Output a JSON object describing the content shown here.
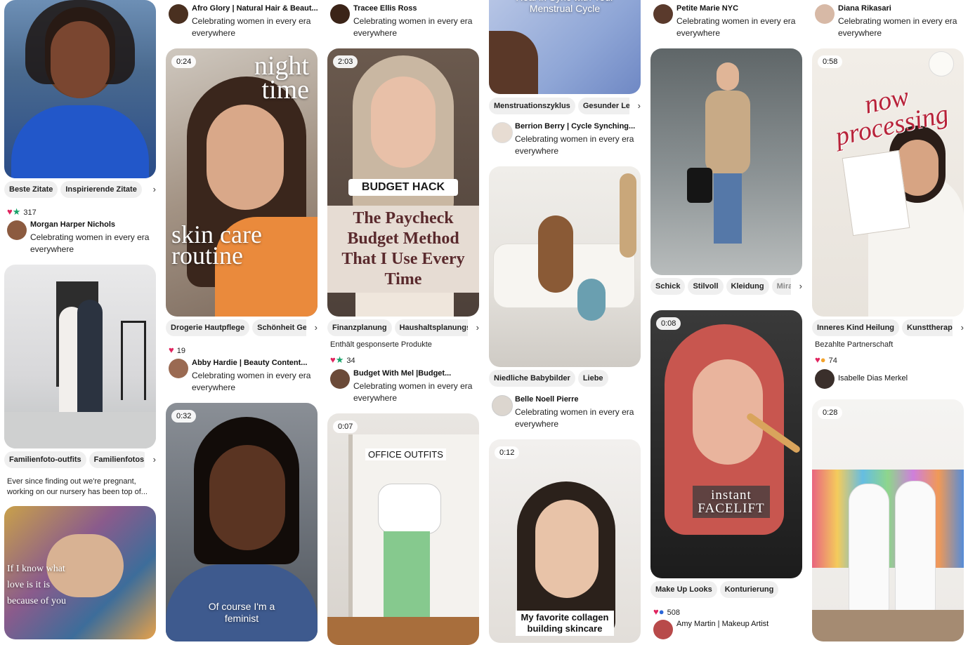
{
  "columns": [
    {
      "pins": [
        {
          "image": "woman in blue top smiling, curly hair",
          "tags": [
            "Beste Zitate",
            "Inspirierende Zitate"
          ],
          "reactions": {
            "count": "317"
          },
          "author": "Morgan Harper Nichols",
          "bio": "Celebrating women in every era everywhere"
        },
        {
          "image": "couple kissing in front of house",
          "tags": [
            "Familienfoto-outfits",
            "Familienfotos"
          ],
          "caption": "Ever since finding out we're pregnant, working on our nursery has been top of..."
        },
        {
          "image": "illustration hands with text",
          "overlay": "If I know what love is it is because of you"
        }
      ]
    },
    {
      "pins": [
        {
          "author": "Afro Glory | Natural Hair & Beaut...",
          "bio": "Celebrating women in every era everywhere"
        },
        {
          "duration": "0:24",
          "overlay_top": "night time",
          "overlay_bottom": "skin care routine",
          "tags": [
            "Drogerie Hautpflege",
            "Schönheit Geh"
          ],
          "reactions": {
            "count": "19"
          },
          "author": "Abby Hardie | Beauty Content...",
          "bio": "Celebrating women in every era everywhere"
        },
        {
          "duration": "0:32",
          "overlay": "Of course I'm a feminist"
        }
      ]
    },
    {
      "pins": [
        {
          "author": "Tracee Ellis Ross",
          "bio": "Celebrating women in every era everywhere"
        },
        {
          "duration": "2:03",
          "badge": "BUDGET HACK",
          "overlay": "The Paycheck Budget Method That I Use Every Time",
          "tags": [
            "Finanzplanung",
            "Haushaltsplanungsti"
          ],
          "sponsored": "Enthält gesponserte Produkte",
          "reactions": {
            "count": "34"
          },
          "author": "Budget With Mel |Budget...",
          "bio": "Celebrating women in every era everywhere"
        },
        {
          "duration": "0:07",
          "overlay": "OFFICE OUTFITS"
        }
      ]
    },
    {
      "pins": [
        {
          "overlay": "Heal in Sync with Your Menstrual Cycle",
          "tags": [
            "Menstruationszyklus",
            "Gesunder Lebe"
          ],
          "author": "Berrion Berry | Cycle Synching...",
          "bio": "Celebrating women in every era everywhere"
        },
        {
          "image": "mother with children on white sofa",
          "tags": [
            "Niedliche Babybilder",
            "Liebe"
          ],
          "author": "Belle Noell Pierre",
          "bio": "Celebrating women in every era everywhere"
        },
        {
          "duration": "0:12",
          "overlay": "My favorite collagen building skincare"
        }
      ]
    },
    {
      "pins": [
        {
          "author": "Petite Marie NYC",
          "bio": "Celebrating women in every era everywhere"
        },
        {
          "image": "woman walking street, blazer and jeans",
          "tags": [
            "Schick",
            "Stilvoll",
            "Kleidung",
            "Miran"
          ]
        },
        {
          "duration": "0:08",
          "overlay": "instant FACELIFT",
          "tags": [
            "Make Up Looks",
            "Konturierung"
          ],
          "reactions": {
            "count": "508"
          },
          "author": "Amy Martin | Makeup Artist"
        }
      ]
    },
    {
      "pins": [
        {
          "author": "Diana Rikasari",
          "bio": "Celebrating women in every era everywhere"
        },
        {
          "duration": "0:58",
          "overlay": "now processing",
          "tags": [
            "Inneres Kind Heilung",
            "Kunsttherapie"
          ],
          "sponsored": "Bezahlte Partnerschaft",
          "reactions": {
            "count": "74"
          },
          "author": "Isabelle Dias Merkel"
        },
        {
          "duration": "0:28",
          "image": "two women in robes and towels, colorful closet"
        }
      ]
    }
  ],
  "colors": {
    "tag_bg": "#efefef",
    "heart": "#e0245e",
    "star": "#18a36a"
  },
  "icons": {
    "more": "chevron-right-icon"
  }
}
